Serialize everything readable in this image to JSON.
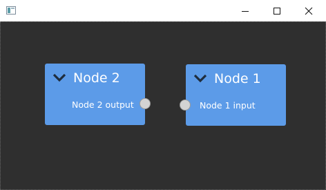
{
  "window": {
    "icons": {
      "app": "app-icon",
      "minimize": "minimize-icon",
      "maximize": "maximize-icon",
      "close": "close-icon"
    }
  },
  "nodes": [
    {
      "title": "Node 2",
      "port_label": "Node 2 output",
      "port_type": "output",
      "icon": "chevron-down-icon"
    },
    {
      "title": "Node 1",
      "port_label": "Node 1 input",
      "port_type": "input",
      "icon": "chevron-down-icon"
    }
  ],
  "colors": {
    "canvas_background": "#2f2f2f",
    "node_background": "#5c9be8",
    "port_fill": "#d3d3d3",
    "text": "#ffffff"
  }
}
